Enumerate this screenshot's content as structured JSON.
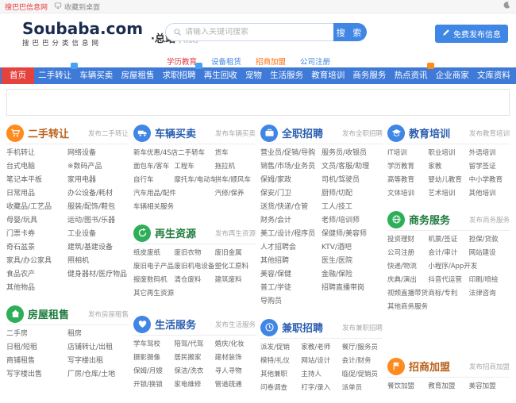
{
  "topbar": {
    "site_name": "搜巴巴信息网",
    "favorite": "收藏到桌面"
  },
  "header": {
    "logo": "Soubaba.com",
    "logo_sub": "搜巴巴分类信息网",
    "station": "·总站",
    "station_switch": "[切换]",
    "search": {
      "placeholder": "请输入关键词搜索",
      "button": "搜 索"
    },
    "publish_button": "免费发布信息"
  },
  "hot_links": [
    {
      "label": "学历教育",
      "color": "red"
    },
    {
      "label": "设备租赁",
      "color": "blue"
    },
    {
      "label": "招商加盟",
      "color": "orange"
    },
    {
      "label": "公司注册",
      "color": "blue"
    }
  ],
  "nav": [
    {
      "label": "首页",
      "active": true
    },
    {
      "label": "二手转让",
      "badge": "blue"
    },
    {
      "label": "车辆买卖"
    },
    {
      "label": "房屋租售"
    },
    {
      "label": "求职招聘",
      "badge": "blue"
    },
    {
      "label": "再生回收"
    },
    {
      "label": "宠物"
    },
    {
      "label": "生活服务"
    },
    {
      "label": "教育培训"
    },
    {
      "label": "商务服务"
    },
    {
      "label": "热点资讯",
      "badge": "orange"
    },
    {
      "label": "企业商家"
    },
    {
      "label": "文库资料"
    }
  ],
  "colors": {
    "nav_blue": "#3f7ad8",
    "active_red": "#e4423c",
    "accent_blue": "#4086e4",
    "accent_orange": "#ff8a1e",
    "accent_green": "#2fae5a",
    "hot_red": "#e4393c",
    "hot_green": "#2a9b2a",
    "hot_purple": "#9b30d0"
  },
  "columns": [
    {
      "blocks": [
        {
          "title": "二手转让",
          "publish": "发布二手转让",
          "icon": "cart-icon",
          "theme": "orange",
          "cols": 2,
          "items": [
            {
              "t": "手机转让",
              "c": "red"
            },
            {
              "t": "网络设备"
            },
            {
              "t": "台式电脑"
            },
            {
              "t": "※数码产品",
              "c": "green"
            },
            {
              "t": "笔记本平板"
            },
            {
              "t": "家用电器",
              "c": "purple"
            },
            {
              "t": "日常用品"
            },
            {
              "t": "办公设备/耗材"
            },
            {
              "t": "收藏品/工艺品"
            },
            {
              "t": "服装/配饰/鞋包"
            },
            {
              "t": "母婴/玩具"
            },
            {
              "t": "运动/图书/乐器"
            },
            {
              "t": "门票卡券"
            },
            {
              "t": "工业设备"
            },
            {
              "t": "奇石盆景"
            },
            {
              "t": "建筑/基建设备"
            },
            {
              "t": "家具/办公家具"
            },
            {
              "t": "照相机"
            },
            {
              "t": "食品农产"
            },
            {
              "t": "健身器材/医疗物品"
            },
            {
              "t": "其他物品"
            }
          ]
        },
        {
          "title": "房屋租售",
          "publish": "发布房屋租售",
          "icon": "house-icon",
          "theme": "green",
          "cols": 2,
          "items": [
            {
              "t": "二手房"
            },
            {
              "t": "租房"
            },
            {
              "t": "日租/短租"
            },
            {
              "t": "店铺转让/出租"
            },
            {
              "t": "商铺租售"
            },
            {
              "t": "写字楼出租"
            },
            {
              "t": "写字楼出售"
            },
            {
              "t": "厂房/仓库/土地"
            }
          ]
        }
      ]
    },
    {
      "blocks": [
        {
          "title": "车辆买卖",
          "publish": "发布车辆买卖",
          "icon": "truck-icon",
          "theme": "blue",
          "cols": 3,
          "items": [
            {
              "t": "新车优惠/4S店二手轿车",
              "w": 2
            },
            {
              "t": "货车"
            },
            {
              "t": "面包车/客车"
            },
            {
              "t": "工程车"
            },
            {
              "t": "拖拉机"
            },
            {
              "t": "自行车"
            },
            {
              "t": "摩托车/电动车"
            },
            {
              "t": "拼车/顺风车"
            },
            {
              "t": "汽车用品/配件",
              "w": 2
            },
            {
              "t": "汽修/保养"
            },
            {
              "t": "车辆相关服务"
            }
          ]
        },
        {
          "title": "再生资源",
          "publish": "发布再生资源",
          "icon": "recycle-icon",
          "theme": "green",
          "cols": 3,
          "items": [
            {
              "t": "纸皮废纸"
            },
            {
              "t": "废旧衣物"
            },
            {
              "t": "废旧金属"
            },
            {
              "t": "废旧电子产品"
            },
            {
              "t": "废旧机电设备"
            },
            {
              "t": "塑化工原料"
            },
            {
              "t": "报废数码机"
            },
            {
              "t": "清仓废料"
            },
            {
              "t": "建筑废料"
            },
            {
              "t": "其它再生资源"
            }
          ]
        },
        {
          "title": "生活服务",
          "publish": "发布生活服务",
          "icon": "heart-icon",
          "theme": "blue",
          "cols": 3,
          "items": [
            {
              "t": "学车驾校"
            },
            {
              "t": "陪驾/代驾"
            },
            {
              "t": "婚庆/化妆"
            },
            {
              "t": "摄影摄像"
            },
            {
              "t": "居民搬家"
            },
            {
              "t": "建材装饰"
            },
            {
              "t": "保姆/月嫂"
            },
            {
              "t": "保洁/洗衣"
            },
            {
              "t": "寻人寻物"
            },
            {
              "t": "开锁/换锁"
            },
            {
              "t": "家电维修"
            },
            {
              "t": "管道疏通"
            }
          ]
        }
      ]
    },
    {
      "blocks": [
        {
          "title": "全职招聘",
          "publish": "发布全职招聘",
          "icon": "briefcase-icon",
          "theme": "blue",
          "cols": 2,
          "items": [
            {
              "t": "营业员/促销/导购"
            },
            {
              "t": "服务员/收银员"
            },
            {
              "t": "销售/市场/业务员",
              "c": "red"
            },
            {
              "t": "文员/客服/助理"
            },
            {
              "t": "保姆/家政"
            },
            {
              "t": "司机/驾驶员"
            },
            {
              "t": "保安/门卫"
            },
            {
              "t": "厨师/切配"
            },
            {
              "t": "送货/快递/仓管"
            },
            {
              "t": "工人/技工"
            },
            {
              "t": "财务/会计"
            },
            {
              "t": "老师/培训师"
            },
            {
              "t": "美工/设计/程序员"
            },
            {
              "t": "保健师/美容师"
            },
            {
              "t": "人才招聘会"
            },
            {
              "t": "KTV/酒吧"
            },
            {
              "t": "其他招聘"
            },
            {
              "t": "医生/医院"
            },
            {
              "t": "美容/保健"
            },
            {
              "t": "金融/保险"
            },
            {
              "t": "普工/学徒"
            },
            {
              "t": "招聘直播带岗"
            },
            {
              "t": "导购员"
            }
          ]
        },
        {
          "title": "兼职招聘",
          "publish": "发布兼职招聘",
          "icon": "clock-icon",
          "theme": "blue",
          "cols": 3,
          "items": [
            {
              "t": "派发/促销"
            },
            {
              "t": "家教/老师"
            },
            {
              "t": "餐厅/服务员"
            },
            {
              "t": "模特/礼仪"
            },
            {
              "t": "网站/设计"
            },
            {
              "t": "会计/财务"
            },
            {
              "t": "其他兼职"
            },
            {
              "t": "主持人"
            },
            {
              "t": "临促/促销员"
            },
            {
              "t": "问卷调查"
            },
            {
              "t": "打字/录入"
            },
            {
              "t": "派单员"
            }
          ]
        }
      ]
    },
    {
      "blocks": [
        {
          "title": "教育培训",
          "publish": "发布教育培训",
          "icon": "graduation-cap-icon",
          "theme": "blue",
          "cols": 3,
          "items": [
            {
              "t": "IT培训"
            },
            {
              "t": "职业培训"
            },
            {
              "t": "外语培训"
            },
            {
              "t": "学历教育"
            },
            {
              "t": "家教"
            },
            {
              "t": "留学签证"
            },
            {
              "t": "高等教育"
            },
            {
              "t": "婴幼儿教育"
            },
            {
              "t": "中小学教育"
            },
            {
              "t": "文体培训"
            },
            {
              "t": "艺术培训"
            },
            {
              "t": "其他培训"
            }
          ]
        },
        {
          "title": "商务服务",
          "publish": "发布商务服务",
          "icon": "globe-icon",
          "theme": "green",
          "cols": 3,
          "items": [
            {
              "t": "投资理财"
            },
            {
              "t": "机票/签证"
            },
            {
              "t": "担保/贷款"
            },
            {
              "t": "公司注册"
            },
            {
              "t": "会计/审计"
            },
            {
              "t": "网站建设"
            },
            {
              "t": "快递/物流"
            },
            {
              "t": "小程序/App开发",
              "w": 2
            },
            {
              "t": "庆典/演出"
            },
            {
              "t": "抖音代运营"
            },
            {
              "t": "印刷/喷绘"
            },
            {
              "t": "视频直播带货"
            },
            {
              "t": "商标/专利"
            },
            {
              "t": "法律咨询"
            },
            {
              "t": "其他商务服务"
            }
          ]
        },
        {
          "title": "招商加盟",
          "publish": "发布招商加盟",
          "icon": "flag-icon",
          "theme": "orange",
          "cols": 3,
          "items": [
            {
              "t": "餐饮加盟"
            },
            {
              "t": "教育加盟"
            },
            {
              "t": "美容加盟"
            }
          ]
        }
      ]
    }
  ]
}
